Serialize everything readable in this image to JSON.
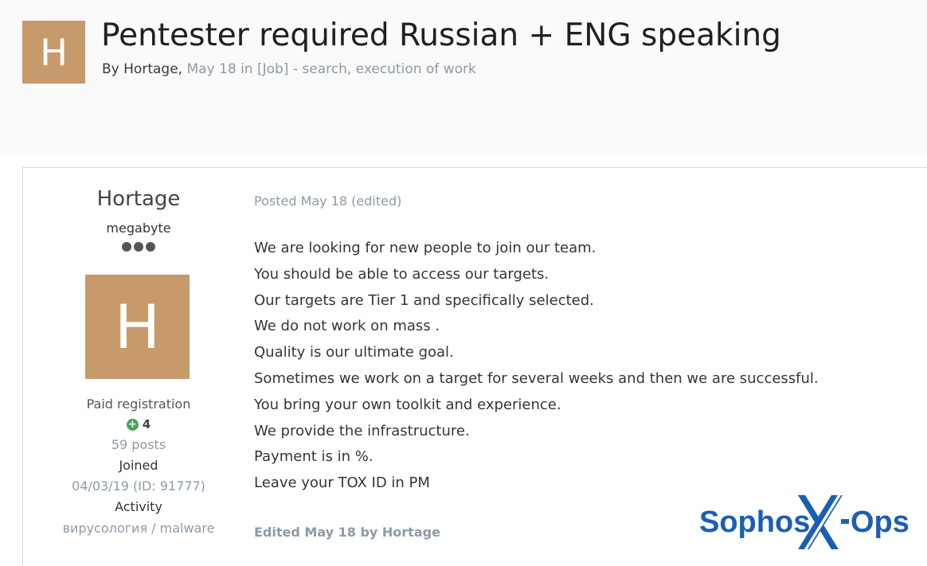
{
  "topic": {
    "avatar_letter": "H",
    "title": "Pentester required Russian + ENG speaking",
    "by_label": "By",
    "author": "Hortage",
    "separator": ",",
    "date": "May 18",
    "in_label": "in",
    "forum": "[Job] - search, execution of work"
  },
  "author_panel": {
    "name": "Hortage",
    "rank": "megabyte",
    "rank_dots": 3,
    "avatar_letter": "H",
    "group": "Paid registration",
    "reputation": "4",
    "posts": "59 posts",
    "joined_label": "Joined",
    "joined_value": "04/03/19 (ID: 91777)",
    "activity_label": "Activity",
    "activity_value": "вирусология / malware"
  },
  "post": {
    "date_line": "Posted May 18 (edited)",
    "lines": [
      "We are looking for new people to join our team.",
      "You should be able to access our targets.",
      "Our targets are Tier 1 and specifically selected.",
      "We do not work on mass .",
      "Quality is our ultimate goal.",
      "Sometimes we work on a target for several weeks and then we are successful.",
      "You bring your own toolkit and experience.",
      "We provide the infrastructure.",
      "Payment is in %.",
      "Leave your TOX ID in PM"
    ],
    "edited_note": "Edited May 18 by Hortage"
  },
  "watermark": {
    "text_left": "Sophos",
    "text_right": "Ops",
    "color": "#1a5fb4"
  },
  "colors": {
    "avatar_bg": "#c69a6b",
    "muted_text": "#8d9aa8",
    "reputation_green": "#4aa35a"
  }
}
